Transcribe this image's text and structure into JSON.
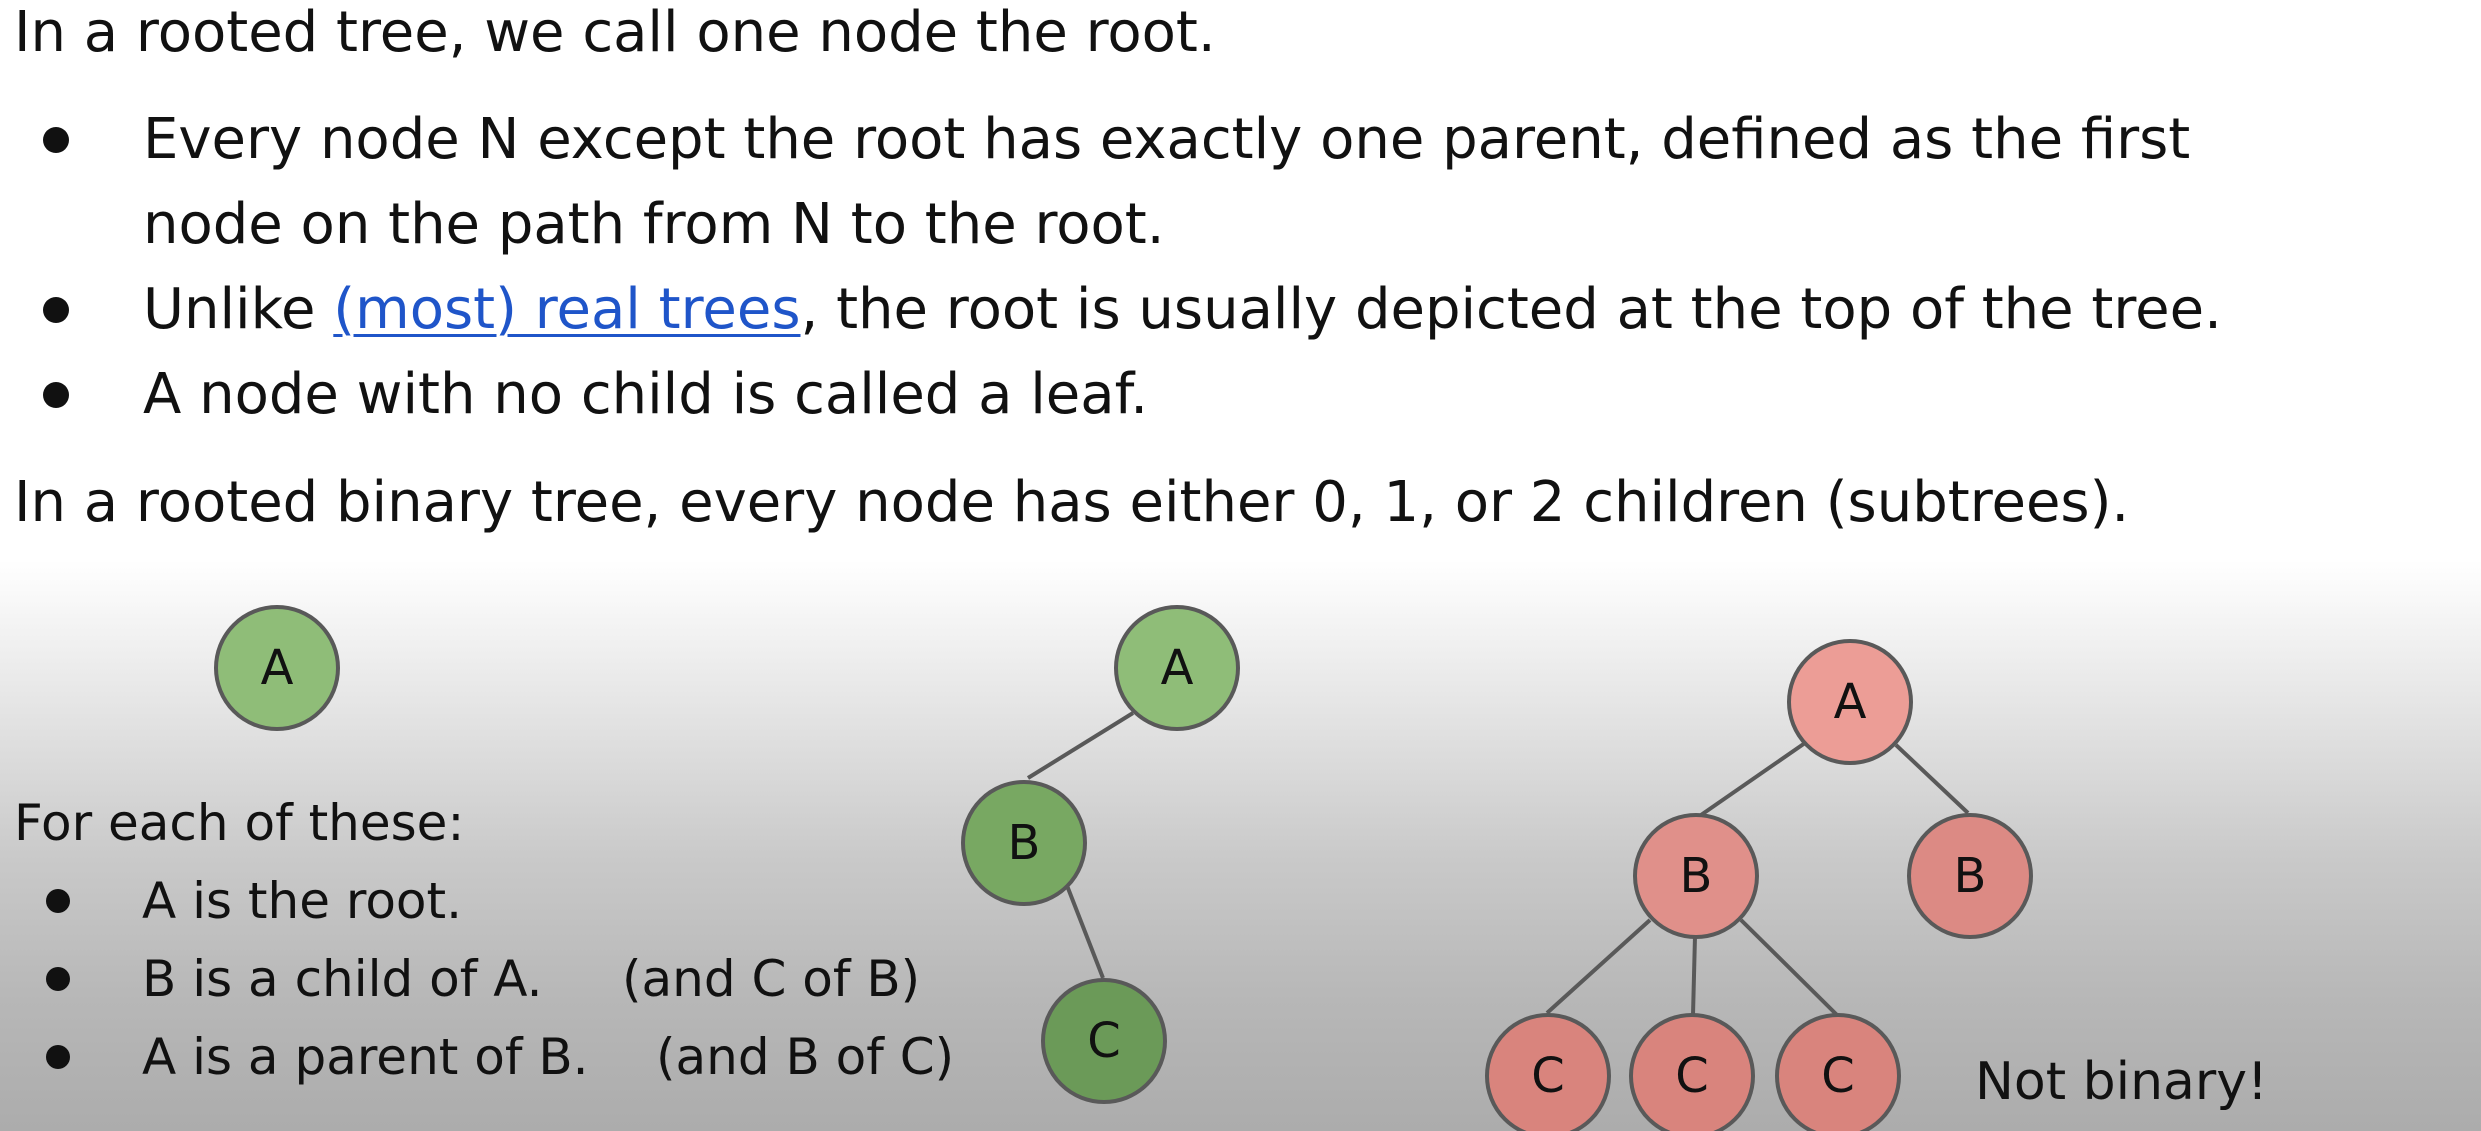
{
  "intro": "In a rooted tree, we call one node the root.",
  "bullets": {
    "b1_line1": "Every node N except the root has exactly one parent, defined as the first",
    "b1_line2": "node on the path from N to the root.",
    "b2_pre": "Unlike ",
    "b2_link": "(most) real trees",
    "b2_post": ", the root is usually depicted at the top of the tree.",
    "b3": "A node with no child is called a leaf."
  },
  "binary_def": "In a rooted binary tree, every node has either 0, 1, or 2 children (subtrees).",
  "examples": {
    "heading": "For each of these:",
    "items": [
      {
        "main": "A is the root.",
        "aside": ""
      },
      {
        "main": "B is a child of A.",
        "aside": "(and C of B)"
      },
      {
        "main": "A is a parent of B.",
        "aside": "(and B of C)"
      }
    ]
  },
  "tree1": {
    "nodes": [
      "A"
    ]
  },
  "tree2": {
    "nodes": [
      "A",
      "B",
      "C"
    ]
  },
  "tree3": {
    "nodes": [
      "A",
      "B",
      "B",
      "C",
      "C",
      "C"
    ],
    "caption": "Not binary!"
  },
  "colors": {
    "green_light": "#8fbd78",
    "green_mid": "#78a862",
    "green_dark": "#6b9a58",
    "red_light": "#ec9d96",
    "red_mid": "#d9847d",
    "stroke": "#595959",
    "link": "#1f55c9"
  }
}
